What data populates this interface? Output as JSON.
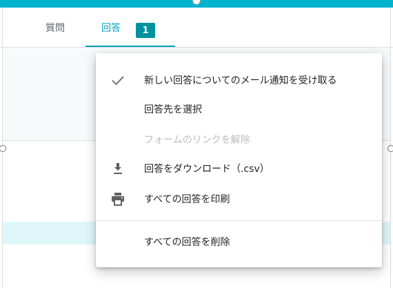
{
  "tabs": {
    "questions_label": "質問",
    "responses_label": "回答",
    "responses_count": "1"
  },
  "menu": {
    "items": [
      {
        "label": "新しい回答についてのメール通知を受け取る",
        "icon": "check-icon",
        "enabled": true,
        "checked": true
      },
      {
        "label": "回答先を選択",
        "icon": "",
        "enabled": true
      },
      {
        "label": "フォームのリンクを解除",
        "icon": "",
        "enabled": false
      },
      {
        "label": "回答をダウンロード（.csv）",
        "icon": "download-icon",
        "enabled": true
      },
      {
        "label": "すべての回答を印刷",
        "icon": "print-icon",
        "enabled": true
      },
      {
        "label": "すべての回答を削除",
        "icon": "",
        "enabled": true
      }
    ]
  },
  "colors": {
    "accent": "#00b4d0",
    "tab_active": "#00a0bc",
    "badge": "#00939f",
    "disabled_text": "#bdbdbd",
    "highlight_row": "#e0f7fa"
  }
}
